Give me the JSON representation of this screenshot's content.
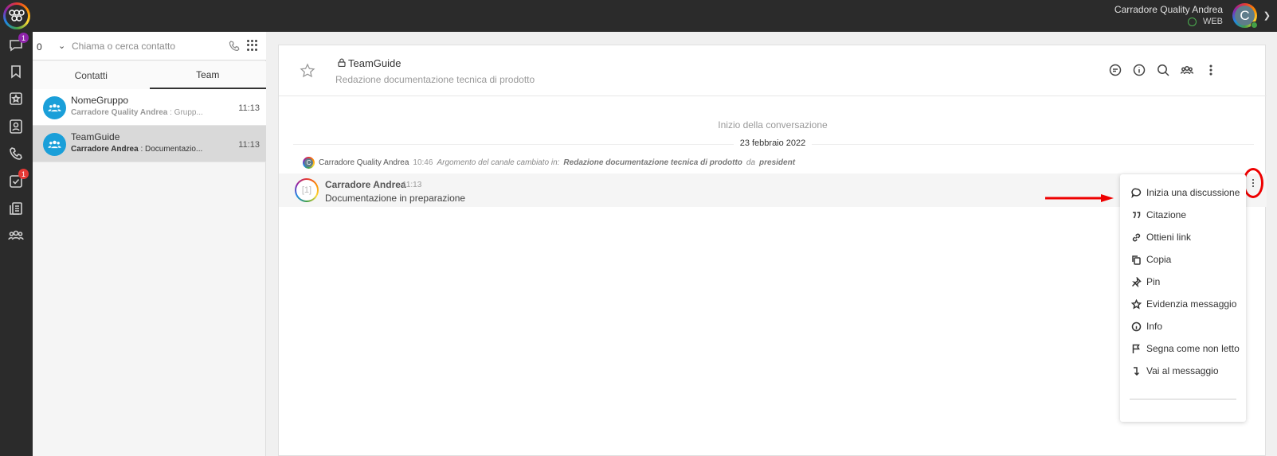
{
  "topbar": {
    "user_name": "Carradore Quality Andrea",
    "user_status": "WEB",
    "avatar_letter": "C"
  },
  "rail": {
    "chat_badge": "1",
    "tasks_badge": "1"
  },
  "panel": {
    "count": "0",
    "search_placeholder": "Chiama o cerca contatto",
    "tabs": [
      {
        "label": "Contatti",
        "active": false
      },
      {
        "label": "Team",
        "active": true
      }
    ],
    "items": [
      {
        "name": "NomeGruppo",
        "sender": "Carradore Quality Andrea",
        "preview": " : Grupp...",
        "time": "11:13",
        "selected": false
      },
      {
        "name": "TeamGuide",
        "sender": "Carradore Andrea",
        "preview": " : Documentazio...",
        "time": "11:13",
        "selected": true
      }
    ]
  },
  "channel": {
    "title": "TeamGuide",
    "topic": "Redazione documentazione tecnica di prodotto"
  },
  "conversation": {
    "start_label": "Inizio della conversazione",
    "date_label": "23 febbraio 2022",
    "system_message": {
      "avatar_letter": "C",
      "user": "Carradore Quality Andrea",
      "time": "10:46",
      "text": "Argomento del canale cambiato in:",
      "bold": "Redazione documentazione tecnica di prodotto",
      "suffix": "da",
      "by": "president"
    },
    "message": {
      "avatar_letter": "[1]",
      "author": "Carradore Andrea",
      "time": "11:13",
      "text": "Documentazione in preparazione"
    }
  },
  "menu": {
    "items": [
      {
        "label": "Inizia una discussione",
        "icon": "discussion-icon"
      },
      {
        "label": "Citazione",
        "icon": "quote-icon"
      },
      {
        "label": "Ottieni link",
        "icon": "link-icon"
      },
      {
        "label": "Copia",
        "icon": "copy-icon"
      },
      {
        "label": "Pin",
        "icon": "pin-icon"
      },
      {
        "label": "Evidenzia messaggio",
        "icon": "star-icon"
      },
      {
        "label": "Info",
        "icon": "info-icon"
      },
      {
        "label": "Segna come non letto",
        "icon": "flag-icon"
      },
      {
        "label": "Vai al messaggio",
        "icon": "jump-icon"
      }
    ]
  },
  "colors": {
    "accent_blue": "#1a9fd9",
    "highlight_red": "#e00000",
    "topbar": "#2b2b2b"
  }
}
